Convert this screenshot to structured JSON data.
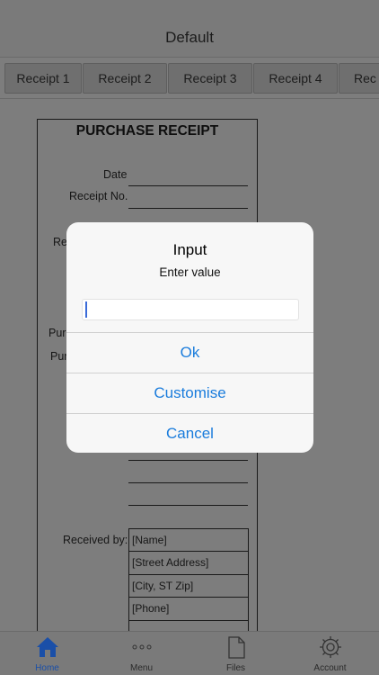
{
  "nav": {
    "title": "Default"
  },
  "receipt_tabs": [
    "Receipt 1",
    "Receipt 2",
    "Receipt 3",
    "Receipt 4",
    "Rec"
  ],
  "receipt": {
    "title": "PURCHASE RECEIPT",
    "date_label": "Date",
    "receipt_no_label": "Receipt No.",
    "partial_label_1": "Re",
    "partial_label_2": "Pur",
    "partial_label_3": "Pur",
    "received_by_label": "Received by:",
    "address_lines": [
      "[Name]",
      "[Street Address]",
      "[City, ST  Zip]",
      "[Phone]",
      ""
    ]
  },
  "dialog": {
    "title": "Input",
    "message": "Enter value",
    "input_value": "",
    "buttons": {
      "ok": "Ok",
      "customise": "Customise",
      "cancel": "Cancel"
    }
  },
  "tabbar": {
    "items": [
      {
        "label": "Home",
        "icon": "home-icon",
        "active": true
      },
      {
        "label": "Menu",
        "icon": "more-dots-icon",
        "active": false
      },
      {
        "label": "Files",
        "icon": "file-icon",
        "active": false
      },
      {
        "label": "Account",
        "icon": "gear-icon",
        "active": false
      }
    ]
  },
  "colors": {
    "accent": "#1a7cdc",
    "active_tab": "#1a4fa8",
    "overlay": "#7d7d7d",
    "dialog_bg": "#f7f7f7"
  }
}
